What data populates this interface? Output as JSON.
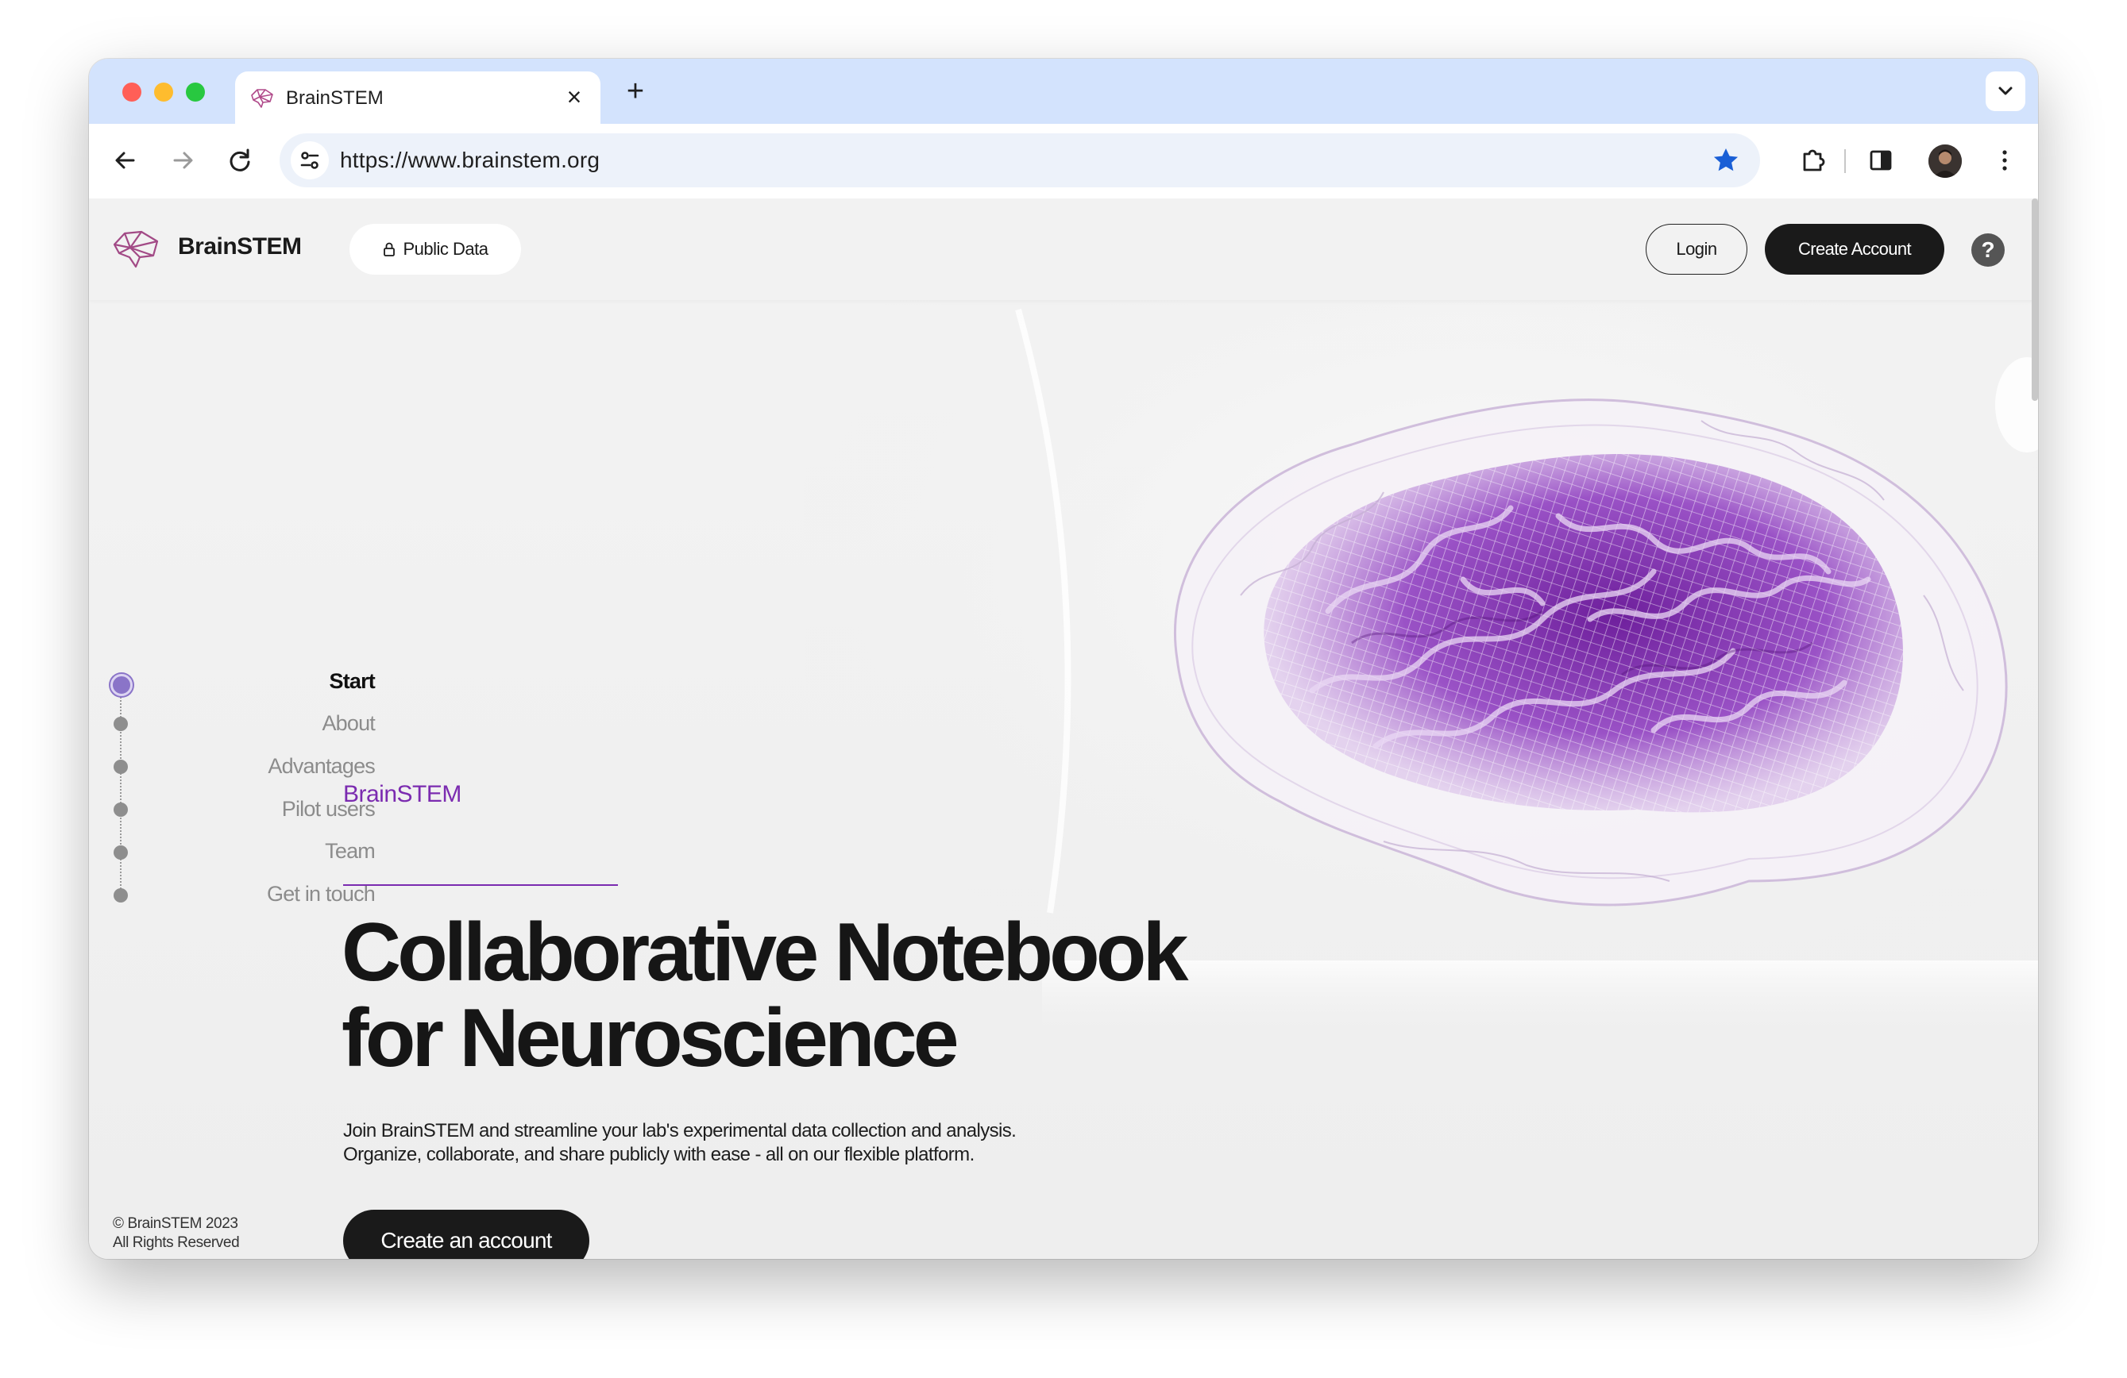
{
  "browser": {
    "tab_title": "BrainSTEM",
    "url": "https://www.brainstem.org",
    "bookmarked": true
  },
  "header": {
    "site_name": "BrainSTEM",
    "public_data_label": "Public Data",
    "login_label": "Login",
    "create_account_label": "Create Account",
    "help_label": "?"
  },
  "sidenav": {
    "items": [
      {
        "label": "Start",
        "active": true
      },
      {
        "label": "About",
        "active": false
      },
      {
        "label": "Advantages",
        "active": false
      },
      {
        "label": "Pilot users",
        "active": false
      },
      {
        "label": "Team",
        "active": false
      },
      {
        "label": "Get in touch",
        "active": false
      }
    ]
  },
  "hero": {
    "eyebrow": "BrainSTEM",
    "headline_line1": "Collaborative Notebook",
    "headline_line2": "for Neuroscience",
    "lede_line1": "Join BrainSTEM and streamline your lab's experimental data collection and analysis.",
    "lede_line2": "Organize, collaborate, and share publicly with ease - all on our flexible platform.",
    "cta_label": "Create an account"
  },
  "footer": {
    "copyright_line1": "© BrainSTEM 2023",
    "copyright_line2": "All Rights Reserved"
  },
  "colors": {
    "accent": "#7b2bb0",
    "brain": "#8a3fb8",
    "tabstrip": "#d3e3fd",
    "dark_button": "#1a1a1a",
    "active_nav_dot": "#8a74c8"
  },
  "icons": [
    "brain-logo-icon",
    "lock-icon",
    "back-arrow-icon",
    "forward-arrow-icon",
    "reload-icon",
    "site-settings-icon",
    "star-icon",
    "extensions-icon",
    "sidepanel-icon",
    "more-vert-icon",
    "chevron-down-icon",
    "close-icon",
    "plus-icon",
    "help-icon"
  ]
}
